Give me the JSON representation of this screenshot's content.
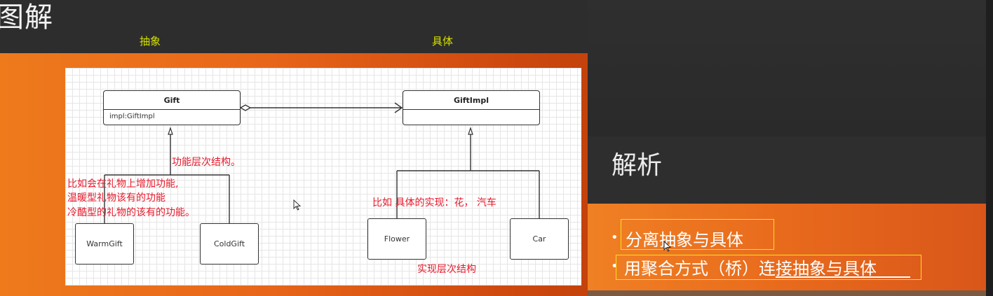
{
  "left": {
    "title": "图解",
    "label_abstract": "抽象",
    "label_concrete": "具体"
  },
  "diagram": {
    "gift": {
      "name": "Gift",
      "attr": "impl:GiftImpl"
    },
    "gift_impl": {
      "name": "GiftImpl"
    },
    "warm_gift": "WarmGift",
    "cold_gift": "ColdGift",
    "flower": "Flower",
    "car": "Car",
    "annotations": {
      "functional_hierarchy": "功能层次结构。",
      "example_line1": "比如会在礼物上增加功能,",
      "example_line2": "温暖型礼物该有的功能",
      "example_line3": "冷酷型的礼物的该有的功能。",
      "concrete_example": "比如 具体的实现：花， 汽车",
      "impl_hierarchy": "实现层次结构"
    }
  },
  "right": {
    "title": "解析",
    "bullets": [
      "分离抽象与具体",
      "用聚合方式（桥）连接抽象与具体"
    ]
  },
  "colors": {
    "accent_yellow": "#d4e000",
    "annotation_red": "#e8182a",
    "highlight_box": "#f3e21f"
  }
}
